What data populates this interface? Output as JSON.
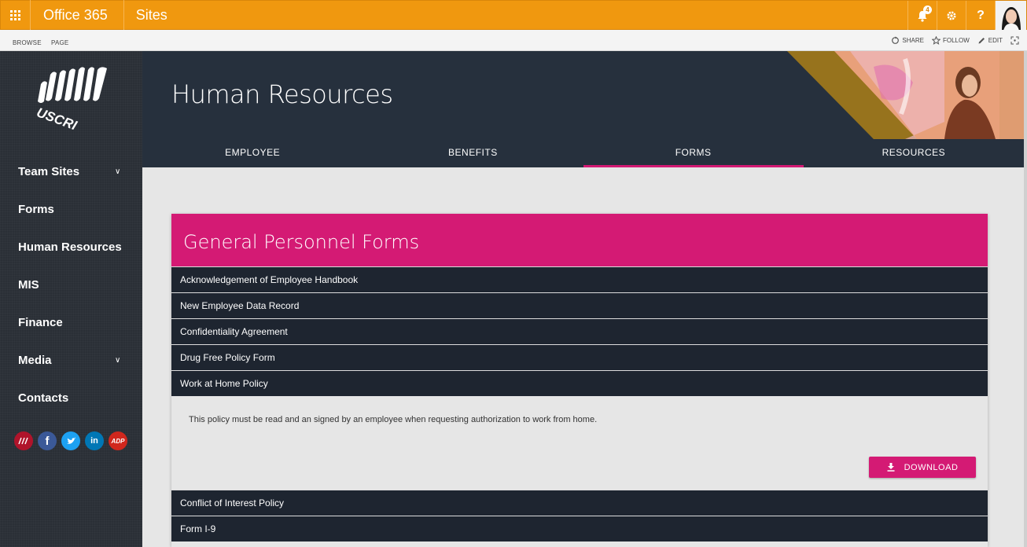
{
  "suitebar": {
    "app_title": "Office 365",
    "section": "Sites",
    "notification_count": "4",
    "help_label": "?"
  },
  "ribbon": {
    "tabs": [
      "BROWSE",
      "PAGE"
    ],
    "actions": {
      "share": "SHARE",
      "follow": "FOLLOW",
      "edit": "EDIT"
    }
  },
  "sidebar": {
    "logo_text": "USCRI",
    "items": [
      {
        "label": "Team Sites",
        "has_children": true
      },
      {
        "label": "Forms",
        "has_children": false
      },
      {
        "label": "Human Resources",
        "has_children": false
      },
      {
        "label": "MIS",
        "has_children": false
      },
      {
        "label": "Finance",
        "has_children": false
      },
      {
        "label": "Media",
        "has_children": true
      },
      {
        "label": "Contacts",
        "has_children": false
      }
    ],
    "social": [
      {
        "name": "news-icon",
        "glyph": "",
        "color": "#b0142b"
      },
      {
        "name": "facebook-icon",
        "glyph": "f",
        "color": "#3b5998"
      },
      {
        "name": "twitter-icon",
        "glyph": "t",
        "color": "#1da1f2"
      },
      {
        "name": "linkedin-icon",
        "glyph": "in",
        "color": "#0077b5"
      },
      {
        "name": "adp-icon",
        "glyph": "ADP",
        "color": "#d0271d"
      }
    ]
  },
  "header": {
    "title": "Human Resources",
    "tabs": [
      {
        "label": "EMPLOYEE",
        "active": false
      },
      {
        "label": "BENEFITS",
        "active": false
      },
      {
        "label": "FORMS",
        "active": true
      },
      {
        "label": "RESOURCES",
        "active": false
      }
    ]
  },
  "panel": {
    "title": "General Personnel Forms",
    "rows_before": [
      "Acknowledgement of Employee Handbook",
      "New Employee Data Record",
      "Confidentiality Agreement",
      "Drug Free Policy Form",
      "Work at Home Policy"
    ],
    "expanded_description": "This policy must be read and an signed by an employee when requesting authorization to work from home.",
    "download_label": "DOWNLOAD",
    "rows_after": [
      "Conflict of Interest Policy",
      "Form I-9"
    ]
  },
  "colors": {
    "suitebar": "#f0980f",
    "accent": "#d41a74",
    "header_bg": "#26303d",
    "row_bg": "#1e2530"
  }
}
